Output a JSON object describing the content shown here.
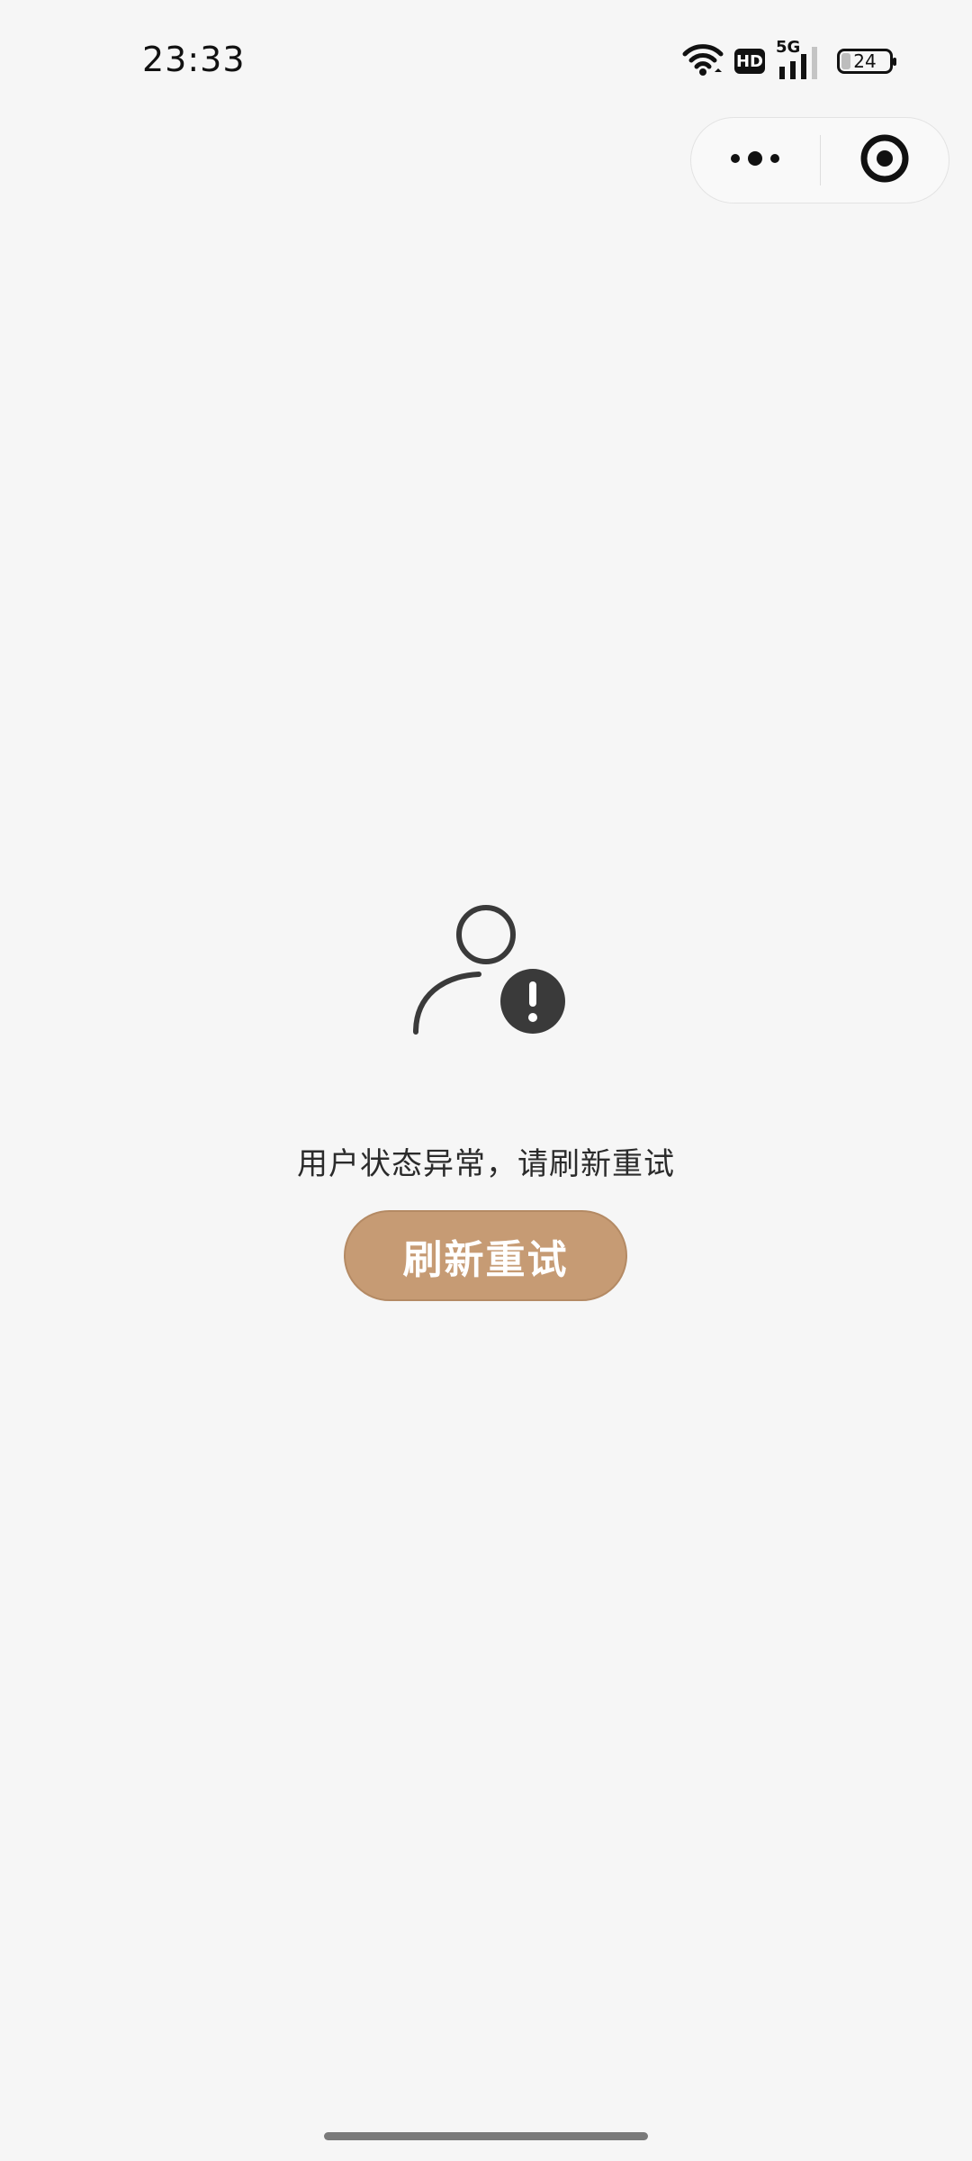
{
  "status_bar": {
    "time": "23:33",
    "network_badge": "HD",
    "signal_label": "5G",
    "battery_level": "24",
    "icons": [
      "wifi-icon",
      "hd-icon",
      "signal-5g-icon",
      "battery-icon"
    ]
  },
  "capsule": {
    "icons": [
      "more-dots-icon",
      "close-target-icon"
    ]
  },
  "main": {
    "icon": "user-warning-icon",
    "message": "用户状态异常，请刷新重试",
    "refresh_label": "刷新重试"
  },
  "colors": {
    "background": "#f6f6f6",
    "accent": "#c69b74",
    "icon": "#3a3a3a"
  }
}
